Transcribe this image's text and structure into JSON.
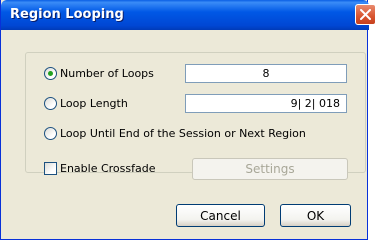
{
  "window": {
    "title": "Region Looping"
  },
  "options": {
    "number_of_loops": {
      "label": "Number of Loops",
      "checked": true,
      "value": "8"
    },
    "loop_length": {
      "label": "Loop Length",
      "checked": false,
      "value": "9| 2| 018"
    },
    "loop_until_end": {
      "label": "Loop Until End of the Session or Next Region",
      "checked": false
    }
  },
  "crossfade": {
    "label": "Enable Crossfade",
    "checked": false,
    "settings_label": "Settings"
  },
  "buttons": {
    "cancel_label": "Cancel",
    "ok_label": "OK"
  },
  "colors": {
    "titlebar": "#0058e6",
    "dialog_bg": "#ece9d8",
    "close_button": "#d8542f",
    "radio_dot": "#21a121"
  }
}
